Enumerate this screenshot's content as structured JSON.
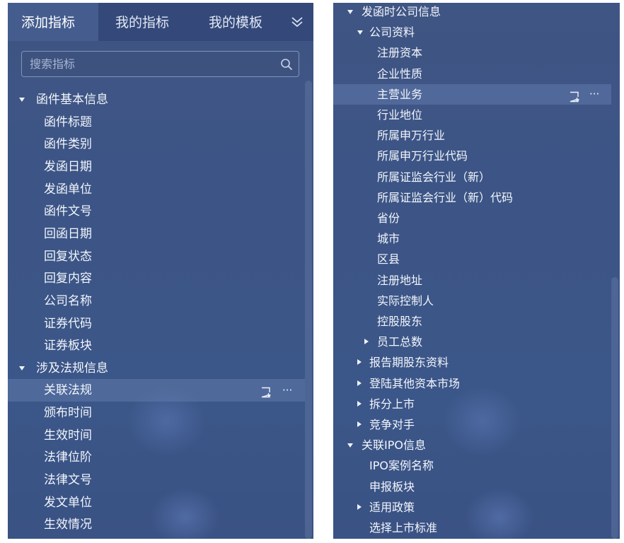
{
  "tabs": [
    {
      "label": "添加指标",
      "active": true
    },
    {
      "label": "我的指标",
      "active": false
    },
    {
      "label": "我的模板",
      "active": false
    }
  ],
  "tab_more_icon": "chevron-double-down-icon",
  "search": {
    "placeholder": "搜索指标",
    "value": "",
    "icon": "search-icon"
  },
  "left_tree": [
    {
      "label": "函件基本信息",
      "level": 0,
      "expanded": true
    },
    {
      "label": "函件标题",
      "level": 1
    },
    {
      "label": "函件类别",
      "level": 1
    },
    {
      "label": "发函日期",
      "level": 1
    },
    {
      "label": "发函单位",
      "level": 1
    },
    {
      "label": "函件文号",
      "level": 1
    },
    {
      "label": "回函日期",
      "level": 1
    },
    {
      "label": "回复状态",
      "level": 1
    },
    {
      "label": "回复内容",
      "level": 1
    },
    {
      "label": "公司名称",
      "level": 1
    },
    {
      "label": "证券代码",
      "level": 1
    },
    {
      "label": "证券板块",
      "level": 1
    },
    {
      "label": "涉及法规信息",
      "level": 0,
      "expanded": true
    },
    {
      "label": "关联法规",
      "level": 1,
      "selected": true
    },
    {
      "label": "颁布时间",
      "level": 1
    },
    {
      "label": "生效时间",
      "level": 1
    },
    {
      "label": "法律位阶",
      "level": 1
    },
    {
      "label": "法律文号",
      "level": 1
    },
    {
      "label": "发文单位",
      "level": 1
    },
    {
      "label": "生效情况",
      "level": 1
    }
  ],
  "right_tree": [
    {
      "label": "发函时公司信息",
      "level": 0,
      "expanded": true
    },
    {
      "label": "公司资料",
      "level": 1,
      "expanded": true
    },
    {
      "label": "注册资本",
      "level": 2
    },
    {
      "label": "企业性质",
      "level": 2
    },
    {
      "label": "主营业务",
      "level": 2,
      "selected": true
    },
    {
      "label": "行业地位",
      "level": 2
    },
    {
      "label": "所属申万行业",
      "level": 2
    },
    {
      "label": "所属申万行业代码",
      "level": 2
    },
    {
      "label": "所属证监会行业（新）",
      "level": 2
    },
    {
      "label": "所属证监会行业（新）代码",
      "level": 2
    },
    {
      "label": "省份",
      "level": 2
    },
    {
      "label": "城市",
      "level": 2
    },
    {
      "label": "区县",
      "level": 2
    },
    {
      "label": "注册地址",
      "level": 2
    },
    {
      "label": "实际控制人",
      "level": 2
    },
    {
      "label": "控股股东",
      "level": 2
    },
    {
      "label": "员工总数",
      "level": 2,
      "expanded": false
    },
    {
      "label": "报告期股东资料",
      "level": 1,
      "expanded": false
    },
    {
      "label": "登陆其他资本市场",
      "level": 1,
      "expanded": false
    },
    {
      "label": "拆分上市",
      "level": 1,
      "expanded": false
    },
    {
      "label": "竞争对手",
      "level": 1,
      "expanded": false
    },
    {
      "label": "关联IPO信息",
      "level": 0,
      "expanded": true
    },
    {
      "label": "IPO案例名称",
      "level": 1
    },
    {
      "label": "申报板块",
      "level": 1
    },
    {
      "label": "适用政策",
      "level": 1,
      "expanded": false
    },
    {
      "label": "选择上市标准",
      "level": 1
    }
  ],
  "row_actions": {
    "edit_icon": "add-note-icon",
    "more_label": "···"
  }
}
